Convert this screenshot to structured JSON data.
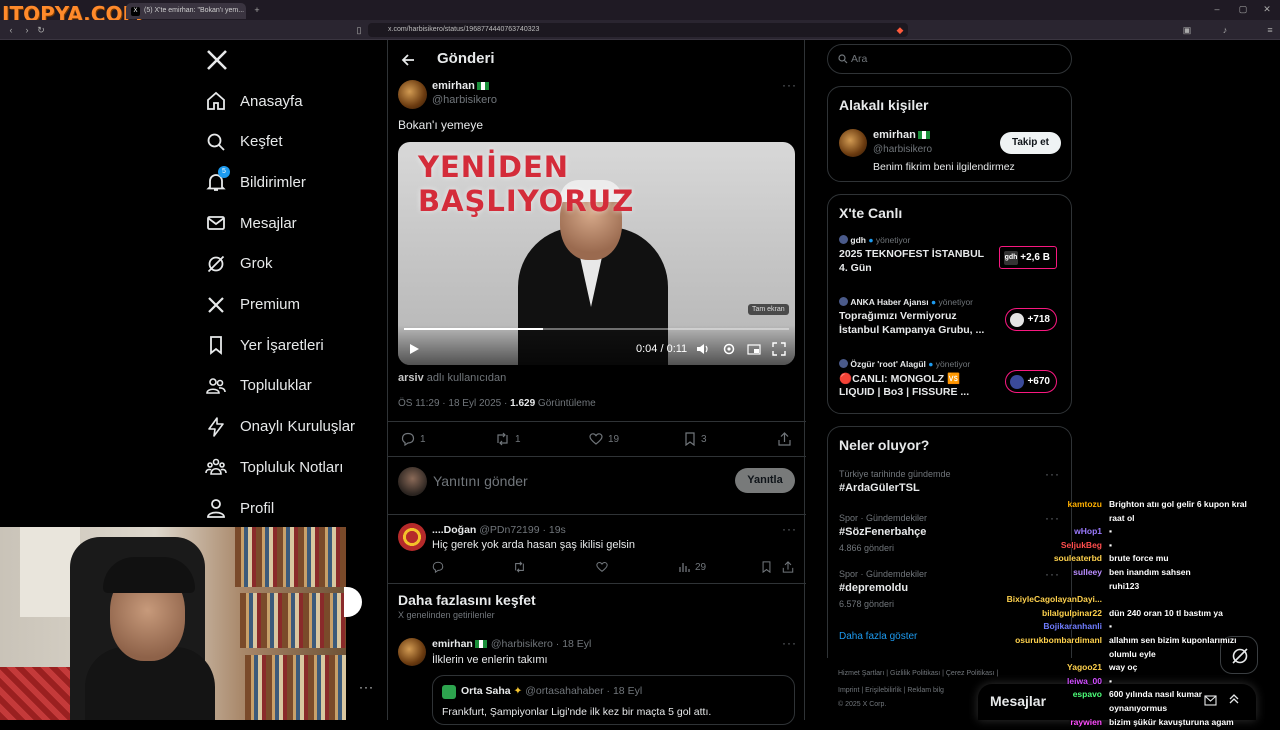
{
  "browser": {
    "watermark": "ITOPYA.COM",
    "tab_title": "(5) X'te emirhan: \"Bokan'ı yem...",
    "url": "x.com/harbisikero/status/1968774440763740323"
  },
  "nav": {
    "items": [
      {
        "label": "Anasayfa",
        "icon": "home-icon"
      },
      {
        "label": "Keşfet",
        "icon": "search-icon"
      },
      {
        "label": "Bildirimler",
        "icon": "bell-icon",
        "badge": "5"
      },
      {
        "label": "Mesajlar",
        "icon": "mail-icon"
      },
      {
        "label": "Grok",
        "icon": "grok-icon"
      },
      {
        "label": "Premium",
        "icon": "x-logo-icon"
      },
      {
        "label": "Yer İşaretleri",
        "icon": "bookmark-icon"
      },
      {
        "label": "Topluluklar",
        "icon": "communities-icon"
      },
      {
        "label": "Onaylı Kuruluşlar",
        "icon": "lightning-icon"
      },
      {
        "label": "Topluluk Notları",
        "icon": "community-notes-icon"
      },
      {
        "label": "Profil",
        "icon": "person-icon"
      }
    ]
  },
  "post": {
    "header": "Gönderi",
    "author_name": "emirhan",
    "author_handle": "@harbisikero",
    "text": "Bokan'ı yemeye",
    "video_title": "YENİDEN BAŞLIYORUZ",
    "video_tooltip": "Tam ekran",
    "video_time": "0:04 / 0:11",
    "video_progress": 0.36,
    "source_user": "arsiv",
    "source_suffix": "adlı kullanıcıdan",
    "timestamp": "ÖS 11:29 · 18 Eyl 2025 · ",
    "views": "1.629",
    "views_label": "Görüntüleme",
    "replies": "1",
    "reposts": "1",
    "likes": "19",
    "bookmarks": "3",
    "reply_placeholder": "Yanıtını gönder",
    "reply_button": "Yanıtla"
  },
  "reply": {
    "name": "....Doğan",
    "handle": "@PDn72199 · 19s",
    "text": "Hiç gerek yok arda hasan şaş ikilisi gelsin",
    "views": "29"
  },
  "discover": {
    "title": "Daha fazlasını keşfet",
    "subtitle": "X genelinden getirilenler",
    "post_name": "emirhan",
    "post_handle": "@harbisikero · 18 Eyl",
    "post_text": "İlklerin ve enlerin takımı",
    "quote_name": "Orta Saha",
    "quote_handle": "@ortasahahaber · 18 Eyl",
    "quote_text": "Frankfurt, Şampiyonlar Ligi'nde ilk kez bir maçta 5 gol attı."
  },
  "right": {
    "search_placeholder": "Ara",
    "related_title": "Alakalı kişiler",
    "related_name": "emirhan",
    "related_handle": "@harbisikero",
    "related_bio": "Benim fikrim beni ilgilendirmez",
    "follow_button": "Takip et",
    "live_title": "X'te Canlı",
    "live": [
      {
        "host": "gdh",
        "role": "yönetiyor",
        "title1": "2025 TEKNOFEST İSTANBUL",
        "title2": "4. Gün",
        "count": "+2,6 B",
        "pill_label": "gdh"
      },
      {
        "host": "ANKA Haber Ajansı",
        "role": "yönetiyor",
        "title1": "Toprağımızı Vermiyoruz",
        "title2": "İstanbul Kampanya Grubu, ...",
        "count": "+718",
        "pill_label": ""
      },
      {
        "host": "Özgür 'root' Alagül",
        "role": "yönetiyor",
        "title1": "🔴CANLI: MONGOLZ 🆚",
        "title2": "LIQUID | Bo3 | FISSURE ...",
        "count": "+670",
        "pill_label": ""
      }
    ],
    "trends_title": "Neler oluyor?",
    "trends": [
      {
        "category": "Türkiye tarihinde gündemde",
        "name": "#ArdaGülerTSL",
        "count": ""
      },
      {
        "category": "Spor · Gündemdekiler",
        "name": "#SözFenerbahçe",
        "count": "4.866 gönderi"
      },
      {
        "category": "Spor · Gündemdekiler",
        "name": "#depremoldu",
        "count": "6.578 gönderi"
      }
    ],
    "show_more": "Daha fazla göster",
    "footer1": "Hizmet Şartları  |  Gizlilik Politikası  |  Çerez Politikası  |",
    "footer2": "Imprint  |  Erişilebilirlik  |  Reklam bilg",
    "footer3": "© 2025 X Corp.",
    "messages_label": "Mesajlar"
  },
  "chat": [
    {
      "user": "kamtozu",
      "msg": "Brighton atıı gol gelir 6 kupon kral",
      "color": "#ffb000"
    },
    {
      "user": "",
      "msg": "raat ol",
      "color": "#ffb000"
    },
    {
      "user": "wHop1",
      "msg": "▪",
      "color": "#9b7bff"
    },
    {
      "user": "SeljukBeg",
      "msg": "▪",
      "color": "#ff4d4d"
    },
    {
      "user": "souleaterbd",
      "msg": "brute force mu",
      "color": "#ffd24d"
    },
    {
      "user": "sulleey",
      "msg": "ben inandım sahsen",
      "color": "#b98cff"
    },
    {
      "user": "",
      "msg": "ruhi123",
      "color": "#ffffff"
    },
    {
      "user": "BixiyleCagolayanDayi...",
      "msg": "",
      "color": "#ffd24d"
    },
    {
      "user": "bilalgulpinar22",
      "msg": "dün 240 oran 10 tl bastım ya",
      "color": "#ffd24d"
    },
    {
      "user": "Bojikaranhanli",
      "msg": "▪",
      "color": "#6f7cff"
    },
    {
      "user": "osurukbombardimanl",
      "msg": "allahım sen bizim kuponlarımızı",
      "color": "#ffd24d"
    },
    {
      "user": "",
      "msg": "olumlu eyle",
      "color": "#ffd24d"
    },
    {
      "user": "Yagoo21",
      "msg": "way oç",
      "color": "#ffd24d"
    },
    {
      "user": "leiwa_00",
      "msg": "▪",
      "color": "#d14dff"
    },
    {
      "user": "espavo",
      "msg": "600 yılında nasıl kumar",
      "color": "#4dff7a"
    },
    {
      "user": "",
      "msg": "oynanıyormus",
      "color": "#4dff7a"
    },
    {
      "user": "raywien",
      "msg": "bizim şükür kavuşturuna agam",
      "color": "#ff4dff"
    }
  ],
  "colors": {
    "accent": "#1d9bf0",
    "live": "#f91880",
    "bg": "#000000"
  }
}
